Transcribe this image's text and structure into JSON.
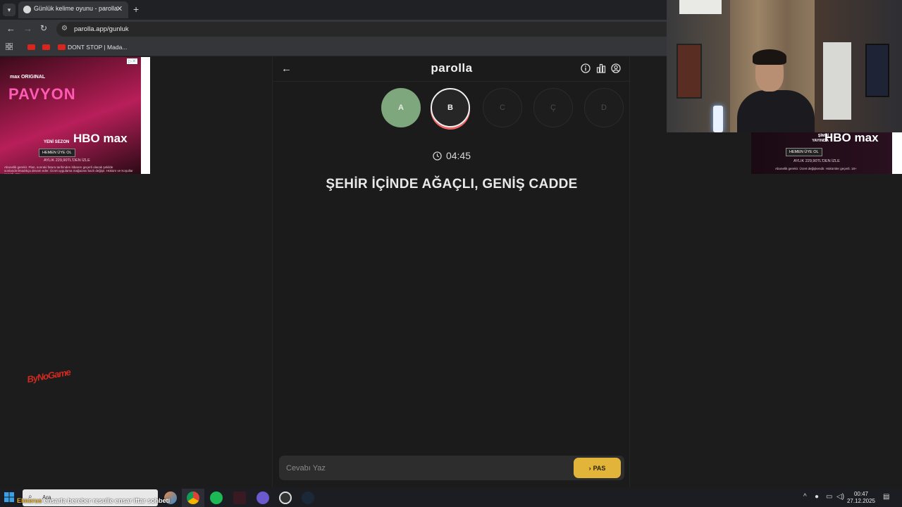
{
  "browser": {
    "tab_title": "Günlük kelime oyunu - parolla",
    "url": "parolla.app/gunluk",
    "bookmark_label": "DONT STOP | Mada..."
  },
  "ads": {
    "left": {
      "brand": "max ORIGINAL",
      "show": "PAVYON",
      "season": "YENİ SEZON",
      "logo": "HBO max",
      "cta": "HEMEN ÜYE OL",
      "price": "AYLIK 229,90TL'DEN İZLE",
      "disclaimer": "Abonelik gerekir. Plan, sonraki fatura tarihinden itibaren geçerli olacak şekilde sonlandırılmadıkça devam eder. Ücret uygulama mağazası bazlı değişir. Hüküm ve Koşullar geçerli. 18+"
    },
    "right": {
      "now": "ŞİMDİ YAYINDA",
      "logo": "HBO max",
      "cta": "HEMEN ÜYE OL",
      "price": "AYLIK 229,90TL'DEN İZLE",
      "disclaimer": "Abonelik gerekir. Ücret değişkendir. Hükümler geçerli. 18+"
    }
  },
  "overlay": {
    "channel_logo": "ByNoGame",
    "ticker_user": "Elmerus",
    "ticker_text": "ensarla bereber resulle ensar iftar sohbeti"
  },
  "game": {
    "title": "parolla",
    "letters": [
      {
        "char": "A",
        "state": "done"
      },
      {
        "char": "B",
        "state": "current"
      },
      {
        "char": "C",
        "state": "pending"
      },
      {
        "char": "Ç",
        "state": "pending"
      },
      {
        "char": "D",
        "state": "pending"
      }
    ],
    "timer": "04:45",
    "clue": "ŞEHİR İÇİNDE AĞAÇLI, GENİŞ CADDE",
    "answer_placeholder": "Cevabı Yaz",
    "answer_value": "",
    "pass_label": "PAS"
  },
  "colors": {
    "done": "#7ea77e",
    "current_ring": "#f0f0f0",
    "pass_button": "#e2b53a",
    "background": "#1b1b1b"
  },
  "taskbar": {
    "search_placeholder": "Ara",
    "time": "00:47",
    "date": "27.12.2025"
  }
}
